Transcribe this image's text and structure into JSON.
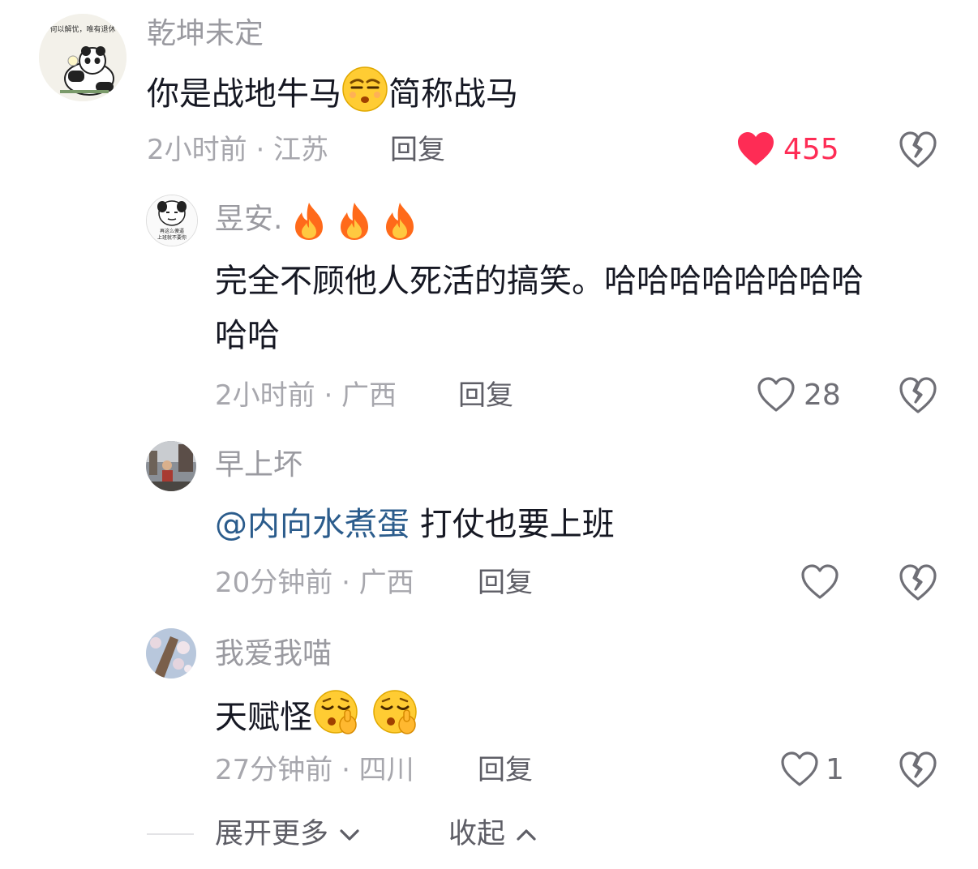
{
  "colors": {
    "like_active": "#fe2c55",
    "mention": "#2b5c8c",
    "meta": "#a7a7ad",
    "name": "#9a9aa0"
  },
  "comments": [
    {
      "username": "乾坤未定",
      "avatar_caption": "何以解忧，唯有退休",
      "text_before": "你是战地牛马",
      "emoji": "smirk-face-icon",
      "text_after": "简称战马",
      "time": "2小时前 · 江苏",
      "reply_label": "回复",
      "likes": "455",
      "liked": true
    },
    {
      "username": "昱安.",
      "name_emojis": [
        "fire-icon",
        "fire-icon",
        "fire-icon"
      ],
      "avatar_caption": "再这么傻逼 上班就不要你",
      "text_line1": "完全不顾他人死活的搞笑。哈哈哈哈哈哈哈哈",
      "text_line2": "哈哈",
      "time": "2小时前 · 广西",
      "reply_label": "回复",
      "likes": "28"
    },
    {
      "username": "早上坏",
      "mention": "@内向水煮蛋",
      "text": "打仗也要上班",
      "time": "20分钟前 · 广西",
      "reply_label": "回复",
      "likes": ""
    },
    {
      "username": "我爱我喵",
      "text": "天赋怪",
      "emojis": [
        "shushing-face-icon",
        "shushing-face-icon"
      ],
      "time": "27分钟前 · 四川",
      "reply_label": "回复",
      "likes": "1"
    }
  ],
  "footer": {
    "expand_label": "展开更多",
    "collapse_label": "收起"
  }
}
